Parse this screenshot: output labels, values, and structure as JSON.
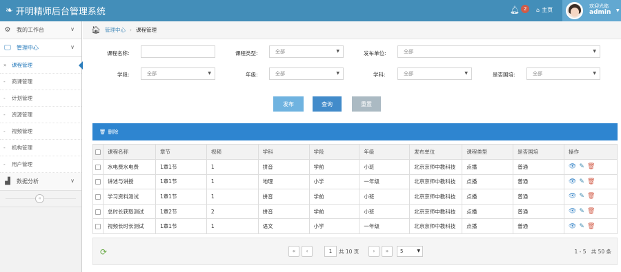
{
  "header": {
    "title": "开明精师后台管理系统",
    "notif_count": "2",
    "home_label": "主页",
    "welcome": "欢迎光临",
    "username": "admin"
  },
  "sidebar": {
    "items": [
      {
        "label": "我的工作台",
        "icon": "dashboard-icon"
      },
      {
        "label": "管理中心",
        "icon": "monitor-icon"
      },
      {
        "label": "数据分析",
        "icon": "bar-chart-icon"
      }
    ],
    "subitems": [
      "课程管理",
      "商课管理",
      "计划管理",
      "资源管理",
      "视频管理",
      "机构管理",
      "用户管理"
    ]
  },
  "breadcrumb": {
    "home": "管理中心",
    "current": "课程管理"
  },
  "filters": {
    "course_name_label": "课程名称:",
    "course_name_value": "",
    "course_type_label": "课程类型:",
    "course_type_value": "全部",
    "publisher_label": "发布单位:",
    "publisher_value": "全部",
    "stage_label": "学段:",
    "stage_value": "全部",
    "grade_label": "年级:",
    "grade_value": "全部",
    "subject_label": "学科:",
    "subject_value": "全部",
    "intl_label": "是否国培:",
    "intl_value": "全部"
  },
  "buttons": {
    "publish": "发布",
    "query": "查询",
    "reset": "重置"
  },
  "panel": {
    "delete_label": "删除"
  },
  "table": {
    "headers": [
      "课程名称",
      "章节",
      "视频",
      "学科",
      "学段",
      "年级",
      "发布单位",
      "课程类型",
      "是否国培",
      "操作"
    ],
    "rows": [
      [
        "水电费水电费",
        "1章1节",
        "1",
        "拼音",
        "学前",
        "小班",
        "北京京师中教科技",
        "点播",
        "普通"
      ],
      [
        "讲述与讲授",
        "1章1节",
        "1",
        "地理",
        "小学",
        "一年级",
        "北京京师中教科技",
        "点播",
        "普通"
      ],
      [
        "学习资料测试",
        "1章1节",
        "1",
        "拼音",
        "学前",
        "小班",
        "北京京师中教科技",
        "点播",
        "普通"
      ],
      [
        "总时长获取测试",
        "1章2节",
        "2",
        "拼音",
        "学前",
        "小班",
        "北京京师中教科技",
        "点播",
        "普通"
      ],
      [
        "视频长时长测试",
        "1章1节",
        "1",
        "语文",
        "小学",
        "一年级",
        "北京京师中教科技",
        "点播",
        "普通"
      ]
    ]
  },
  "pager": {
    "current_page": "1",
    "total_pages_text": "共 10 页",
    "page_size": "5",
    "range_text": "1 - 5",
    "total_text": "共 50 条"
  },
  "colors": {
    "topbar": "#438eb9",
    "accent": "#2e85d0",
    "publish_btn": "#6fb3e0",
    "query_btn": "#428bca",
    "reset_btn": "#abbac3"
  }
}
